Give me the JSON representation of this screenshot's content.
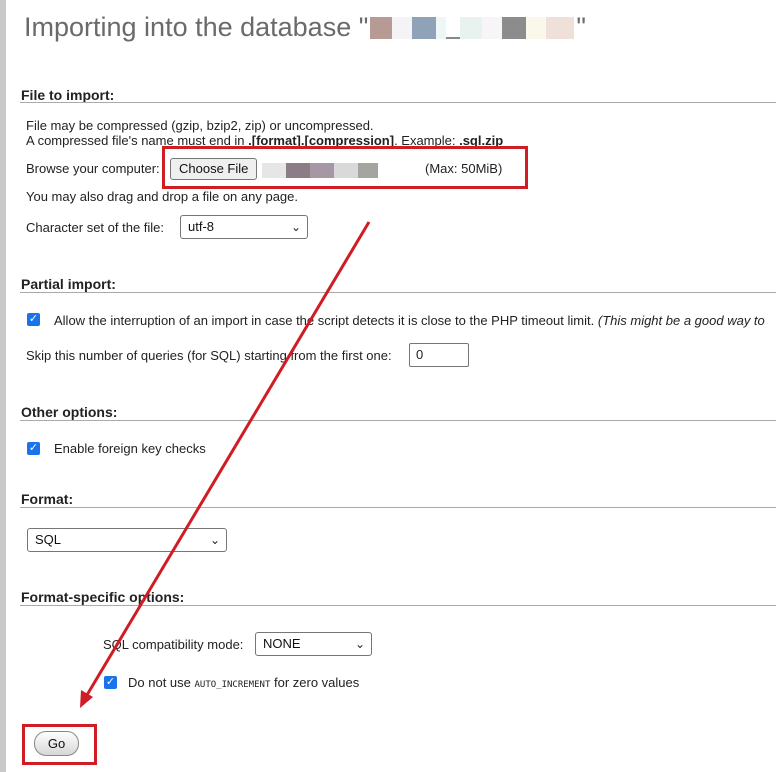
{
  "page": {
    "title_prefix": "Importing into the database \"",
    "title_suffix": "\""
  },
  "file_import": {
    "section_title": "File to import:",
    "note_line1": "File may be compressed (gzip, bzip2, zip) or uncompressed.",
    "note_line2_prefix": "A compressed file's name must end in ",
    "note_line2_format": ".[format].[compression]",
    "note_line2_middle": ". Example: ",
    "note_line2_example": ".sql.zip",
    "browse_label": "Browse your computer:",
    "choose_file_label": "Choose File",
    "max_size": "(Max: 50MiB)",
    "drag_drop_note": "You may also drag and drop a file on any page.",
    "charset_label": "Character set of the file:",
    "charset_value": "utf-8"
  },
  "partial_import": {
    "section_title": "Partial import:",
    "allow_interrupt_label": "Allow the interruption of an import in case the script detects it is close to the PHP timeout limit.",
    "allow_interrupt_hint": "(This might be a good way to",
    "allow_interrupt_checked": true,
    "skip_label": "Skip this number of queries (for SQL) starting from the first one:",
    "skip_value": "0"
  },
  "other_options": {
    "section_title": "Other options:",
    "foreign_key_label": "Enable foreign key checks",
    "foreign_key_checked": true
  },
  "format": {
    "section_title": "Format:",
    "value": "SQL"
  },
  "format_specific": {
    "section_title": "Format-specific options:",
    "compat_label": "SQL compatibility mode:",
    "compat_value": "NONE",
    "auto_inc_prefix": "Do not use ",
    "auto_inc_code": "AUTO_INCREMENT",
    "auto_inc_suffix": " for zero values",
    "auto_inc_checked": true
  },
  "actions": {
    "go_label": "Go"
  },
  "icons": {
    "check": "checkmark-icon",
    "chevron": "chevron-down-icon"
  },
  "colors": {
    "annotation_red": "#d01c24",
    "checkbox_blue": "#1a73e8",
    "title_gray": "#6a6a6a"
  }
}
